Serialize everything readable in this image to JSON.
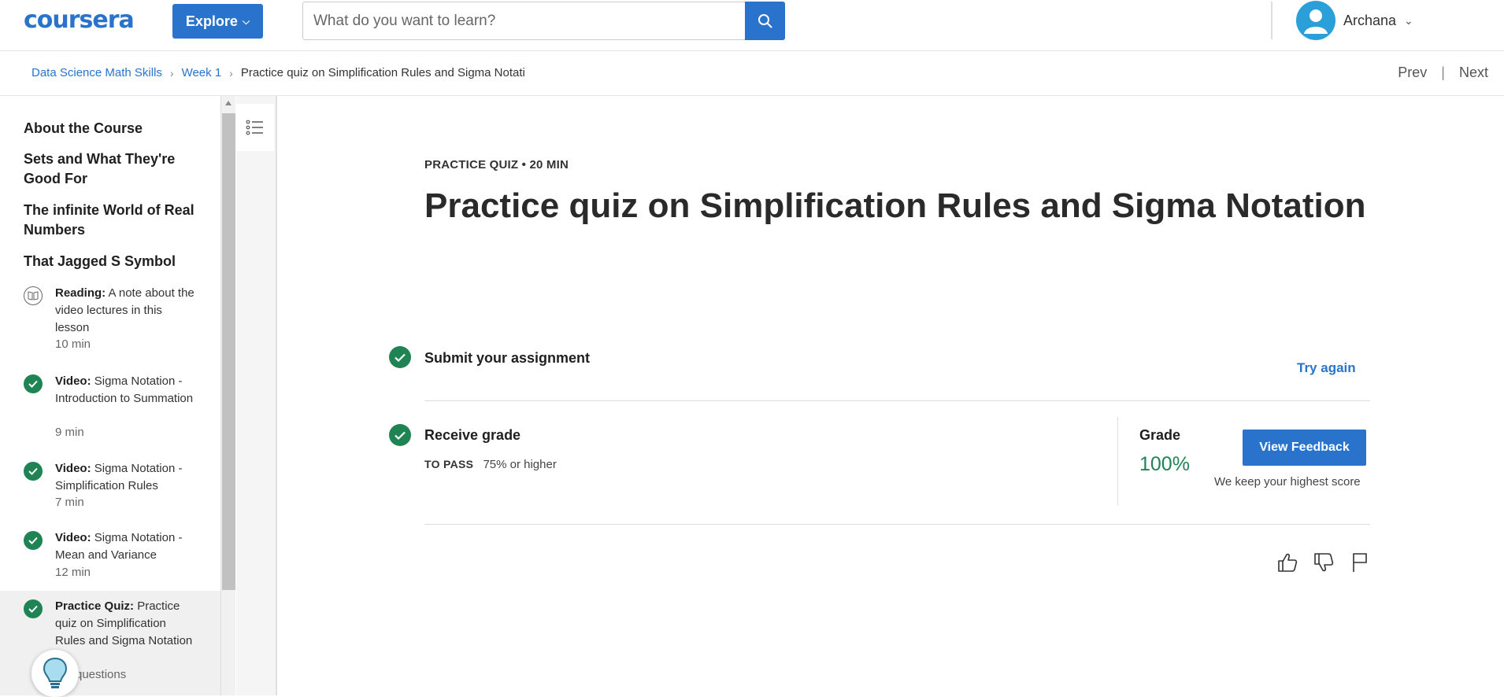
{
  "header": {
    "logo_text": "coursera",
    "explore_label": "Explore",
    "search_placeholder": "What do you want to learn?",
    "user_name": "Archana",
    "brand_color": "#2a73cc"
  },
  "breadcrumb": {
    "items": [
      "Data Science Math Skills",
      "Week 1"
    ],
    "current": "Practice quiz on Simplification Rules and Sigma Notati"
  },
  "nav": {
    "prev": "Prev",
    "next": "Next",
    "separator": "|"
  },
  "sidebar": {
    "sections": [
      "About the Course",
      "Sets and What They're Good For",
      "The infinite World of Real Numbers",
      "That Jagged S Symbol"
    ],
    "items": [
      {
        "type": "Reading:",
        "title": "A note about the video lectures in this lesson",
        "duration": "10 min",
        "status": "reading"
      },
      {
        "type": "Video:",
        "title": "Sigma Notation - Introduction to Summation",
        "duration": "9 min",
        "status": "completed"
      },
      {
        "type": "Video:",
        "title": "Sigma Notation - Simplification Rules",
        "duration": "7 min",
        "status": "completed"
      },
      {
        "type": "Video:",
        "title": "Sigma Notation - Mean and Variance",
        "duration": "12 min",
        "status": "completed"
      },
      {
        "type": "Practice Quiz:",
        "title": "Practice quiz on Simplification Rules and Sigma Notation",
        "duration": "questions",
        "status": "completed"
      }
    ]
  },
  "main": {
    "eyebrow": "PRACTICE QUIZ • 20 MIN",
    "title": "Practice quiz on Simplification Rules and Sigma Notation",
    "submit_title": "Submit your assignment",
    "try_again": "Try again",
    "receive_title": "Receive grade",
    "to_pass_label": "TO PASS",
    "to_pass_value": "75% or higher",
    "grade_label": "Grade",
    "grade_value": "100%",
    "view_feedback": "View Feedback",
    "keep_note": "We keep your highest score"
  },
  "colors": {
    "success": "#1f8354",
    "link": "#2a73cc"
  }
}
